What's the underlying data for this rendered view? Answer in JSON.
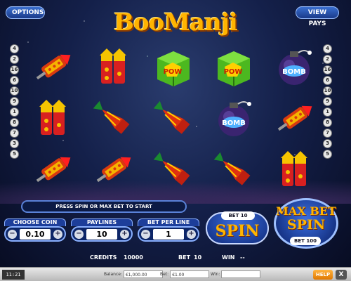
{
  "header": {
    "options_label": "OPTIONS",
    "paytable_label": "VIEW PAYS",
    "logo_text": "BooManji"
  },
  "paylines": {
    "left": [
      "4",
      "2",
      "16",
      "6",
      "10",
      "9",
      "1",
      "8",
      "7",
      "3",
      "5"
    ],
    "right": [
      "4",
      "2",
      "16",
      "6",
      "10",
      "9",
      "1",
      "8",
      "7",
      "3",
      "5"
    ]
  },
  "reels": [
    [
      "rocket",
      "bottle-rocket",
      "rocket"
    ],
    [
      "bottle-rocket",
      "firework-cone",
      "rocket"
    ],
    [
      "pow-box",
      "firework-cone",
      "firework-cone"
    ],
    [
      "pow-box",
      "bomb",
      "firework-cone"
    ],
    [
      "bomb",
      "rocket",
      "bottle-rocket"
    ]
  ],
  "message": "PRESS SPIN OR MAX BET TO START",
  "controls": {
    "coin": {
      "label": "CHOOSE COIN",
      "value": "0.10",
      "minus": "−",
      "plus": "+"
    },
    "lines": {
      "label": "PAYLINES",
      "value": "10",
      "minus": "−",
      "plus": "+"
    },
    "bet": {
      "label": "BET PER LINE",
      "value": "1",
      "minus": "−",
      "plus": "+"
    }
  },
  "spin": {
    "bet_label": "BET",
    "bet_value": "10",
    "label": "SPIN"
  },
  "maxbet": {
    "line1": "MAX BET",
    "line2": "SPIN",
    "bet_label": "BET",
    "bet_value": "100"
  },
  "info": {
    "credits_label": "CREDITS",
    "credits_value": "10000",
    "bet_label": "BET",
    "bet_value": "10",
    "win_label": "WIN",
    "win_value": "--"
  },
  "status_bar": {
    "clock": "11:21",
    "balance_label": "Balance:",
    "balance_value": "€1,000.00",
    "bet_label": "Bet:",
    "bet_value": "€1.00",
    "win_label": "Win:",
    "win_value": "",
    "help_label": "HELP",
    "close_label": "X"
  },
  "colors": {
    "logo": "#ffb400",
    "panel": "#1d3e9a",
    "accent": "#8ab0ff"
  }
}
